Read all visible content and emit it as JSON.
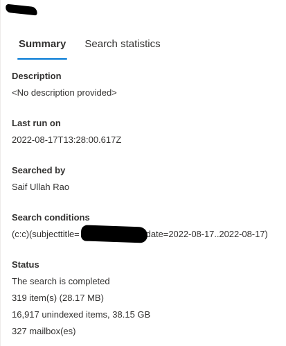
{
  "tabs": [
    {
      "label": "Summary",
      "active": true
    },
    {
      "label": "Search statistics",
      "active": false
    }
  ],
  "description": {
    "label": "Description",
    "value": "<No description provided>"
  },
  "last_run": {
    "label": "Last run on",
    "value": "2022-08-17T13:28:00.617Z"
  },
  "searched_by": {
    "label": "Searched by",
    "value": "Saif Ullah Rao"
  },
  "conditions": {
    "label": "Search conditions",
    "value_start": "(c:c)(subjecttitle=",
    "value_end": "date=2022-08-17..2022-08-17)"
  },
  "status": {
    "label": "Status",
    "lines": [
      "The search is completed",
      "319 item(s) (28.17 MB)",
      "16,917 unindexed items, 38.15 GB",
      "327 mailbox(es)"
    ]
  },
  "colors": {
    "accent": "#0078d4",
    "text": "#323130",
    "redaction": "#000000"
  }
}
